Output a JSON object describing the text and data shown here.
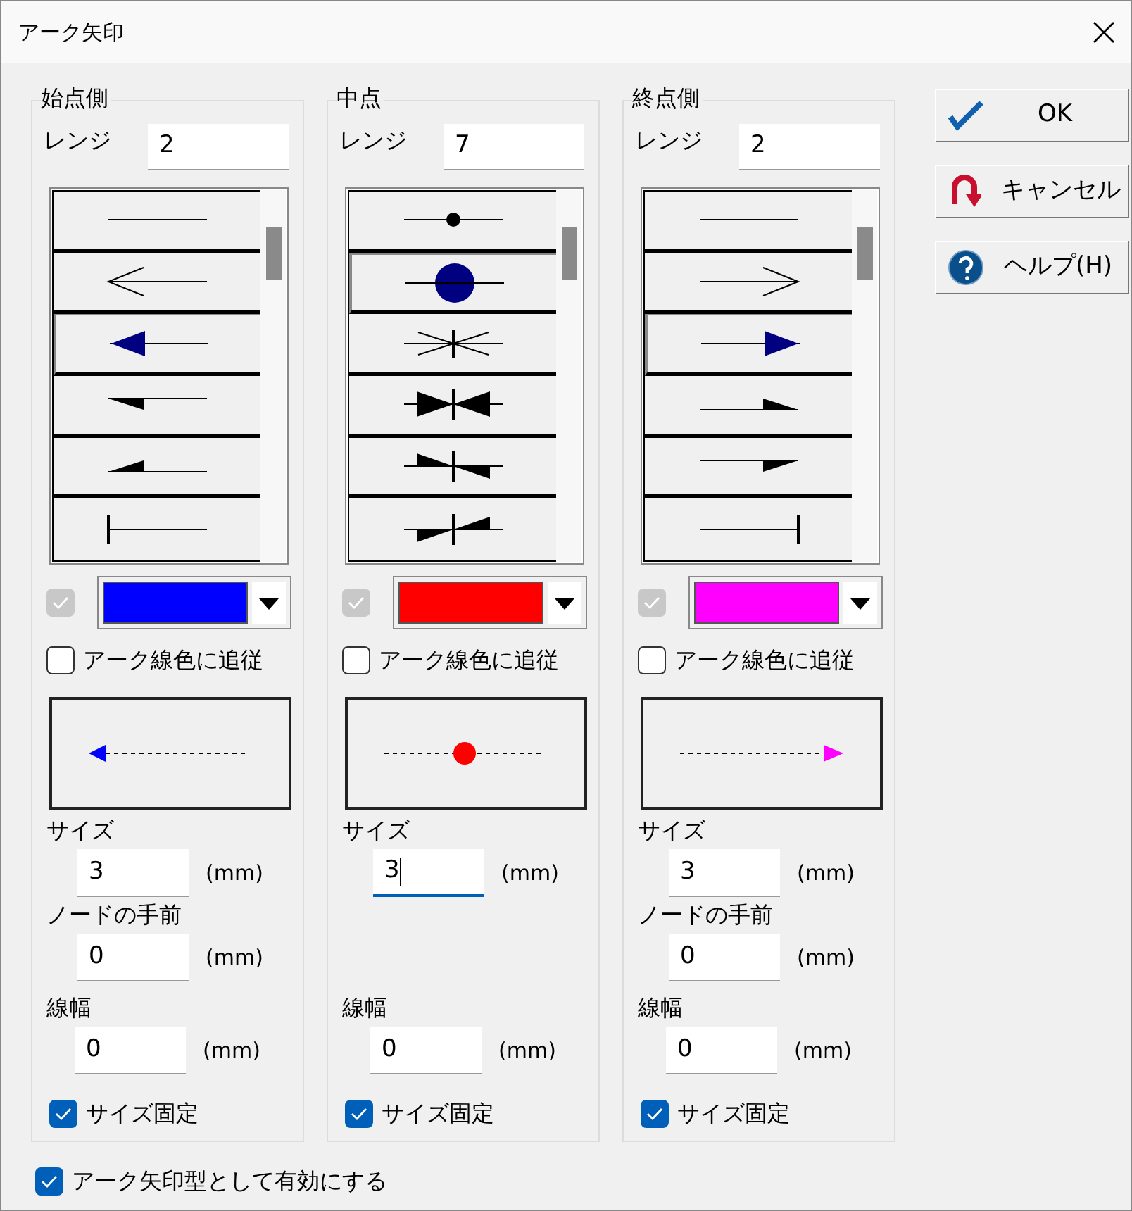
{
  "window": {
    "title": "アーク矢印"
  },
  "columns": [
    {
      "title": "始点側",
      "kind": "start",
      "range_label": "レンジ",
      "range_value": "2",
      "styles": [
        {
          "kind": "plain",
          "selected": false
        },
        {
          "kind": "open",
          "selected": false
        },
        {
          "kind": "filled",
          "selected": true
        },
        {
          "kind": "half-lower",
          "selected": false
        },
        {
          "kind": "half-upper",
          "selected": false
        },
        {
          "kind": "bar",
          "selected": false
        }
      ],
      "color_enabled": {
        "checked": true,
        "disabled": true
      },
      "color": "#0000ff",
      "follow": {
        "label": "アーク線色に追従",
        "checked": false
      },
      "size": {
        "label": "サイズ",
        "value": "3",
        "unit": "(mm)",
        "focused": false
      },
      "node_offset": {
        "label": "ノードの手前",
        "value": "0",
        "unit": "(mm)",
        "focused": false
      },
      "line_width": {
        "label": "線幅",
        "value": "0",
        "unit": "(mm)",
        "focused": false
      },
      "fixed": {
        "label": "サイズ固定",
        "checked": true
      }
    },
    {
      "title": "中点",
      "kind": "middle",
      "range_label": "レンジ",
      "range_value": "7",
      "styles": [
        {
          "kind": "dot",
          "selected": false
        },
        {
          "kind": "big-dot",
          "selected": true
        },
        {
          "kind": "cross",
          "selected": false
        },
        {
          "kind": "bowtie",
          "selected": false
        },
        {
          "kind": "half-bowtie-a",
          "selected": false
        },
        {
          "kind": "half-bowtie-b",
          "selected": false
        }
      ],
      "color_enabled": {
        "checked": true,
        "disabled": true
      },
      "color": "#ff0000",
      "follow": {
        "label": "アーク線色に追従",
        "checked": false
      },
      "size": {
        "label": "サイズ",
        "value": "3",
        "unit": "(mm)",
        "focused": true
      },
      "line_width": {
        "label": "線幅",
        "value": "0",
        "unit": "(mm)",
        "focused": false
      },
      "fixed": {
        "label": "サイズ固定",
        "checked": true
      }
    },
    {
      "title": "終点側",
      "kind": "end",
      "range_label": "レンジ",
      "range_value": "2",
      "styles": [
        {
          "kind": "plain",
          "selected": false
        },
        {
          "kind": "open",
          "selected": false
        },
        {
          "kind": "filled",
          "selected": true
        },
        {
          "kind": "half-lower",
          "selected": false
        },
        {
          "kind": "half-upper",
          "selected": false
        },
        {
          "kind": "bar",
          "selected": false
        }
      ],
      "color_enabled": {
        "checked": true,
        "disabled": true
      },
      "color": "#ff00ff",
      "follow": {
        "label": "アーク線色に追従",
        "checked": false
      },
      "size": {
        "label": "サイズ",
        "value": "3",
        "unit": "(mm)",
        "focused": false
      },
      "node_offset": {
        "label": "ノードの手前",
        "value": "0",
        "unit": "(mm)",
        "focused": false
      },
      "line_width": {
        "label": "線幅",
        "value": "0",
        "unit": "(mm)",
        "focused": false
      },
      "fixed": {
        "label": "サイズ固定",
        "checked": true
      }
    }
  ],
  "buttons": [
    {
      "kind": "ok",
      "label": "OK"
    },
    {
      "kind": "cancel",
      "label": "キャンセル"
    },
    {
      "kind": "help",
      "label": "ヘルプ(H)"
    }
  ],
  "enable": {
    "label": "アーク矢印型として有効にする",
    "checked": true
  }
}
